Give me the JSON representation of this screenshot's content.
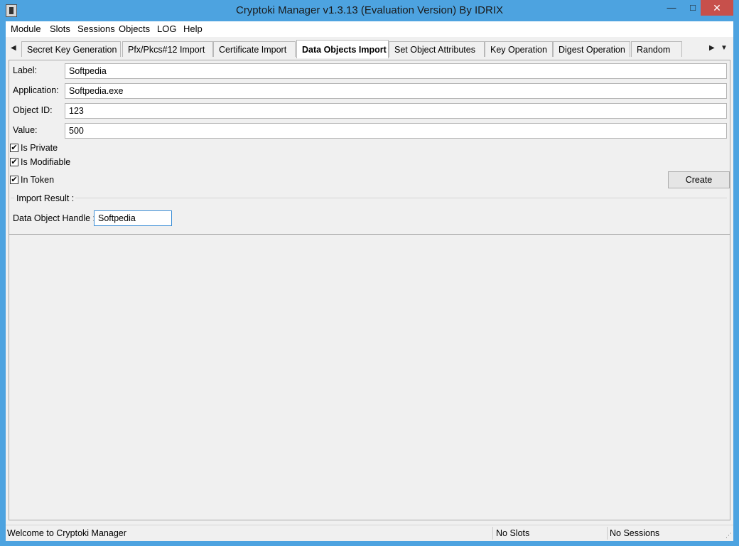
{
  "window": {
    "title": "Cryptoki Manager v1.3.13  (Evaluation Version)  By IDRIX",
    "controls": {
      "minimize": "—",
      "maximize": "□",
      "close": "✕"
    }
  },
  "menu": [
    "Module",
    "Slots",
    "Sessions",
    "Objects",
    "LOG",
    "Help"
  ],
  "tabs": [
    {
      "label": "Secret Key Generation",
      "active": false
    },
    {
      "label": "Pfx/Pkcs#12 Import",
      "active": false
    },
    {
      "label": "Certificate Import",
      "active": false
    },
    {
      "label": "Data Objects Import",
      "active": true
    },
    {
      "label": "Set Object Attributes",
      "active": false
    },
    {
      "label": "Key Operation",
      "active": false
    },
    {
      "label": "Digest Operation",
      "active": false
    },
    {
      "label": "Random",
      "active": false
    }
  ],
  "form": {
    "label": {
      "caption": "Label:",
      "value": "Softpedia"
    },
    "application": {
      "caption": "Application:",
      "value": "Softpedia.exe"
    },
    "object_id": {
      "caption": "Object ID:",
      "value": "123"
    },
    "value": {
      "caption": "Value:",
      "value": "500"
    },
    "is_private": {
      "caption": "Is Private",
      "checked": true
    },
    "is_modifiable": {
      "caption": "Is Modifiable",
      "checked": true
    },
    "in_token": {
      "caption": "In Token",
      "checked": true
    },
    "create_button": "Create"
  },
  "import_result": {
    "group_title": "Import Result :",
    "handle_caption": "Data Object Handle :",
    "handle_value": "Softpedia"
  },
  "statusbar": {
    "message": "Welcome to Cryptoki Manager",
    "slots": "No Slots",
    "sessions": "No Sessions"
  },
  "icons": {
    "tab_scroll_left": "◀",
    "tab_scroll_right": "▶",
    "tab_list": "▼",
    "checkmark": "✔",
    "resize_grip": "⋰"
  }
}
